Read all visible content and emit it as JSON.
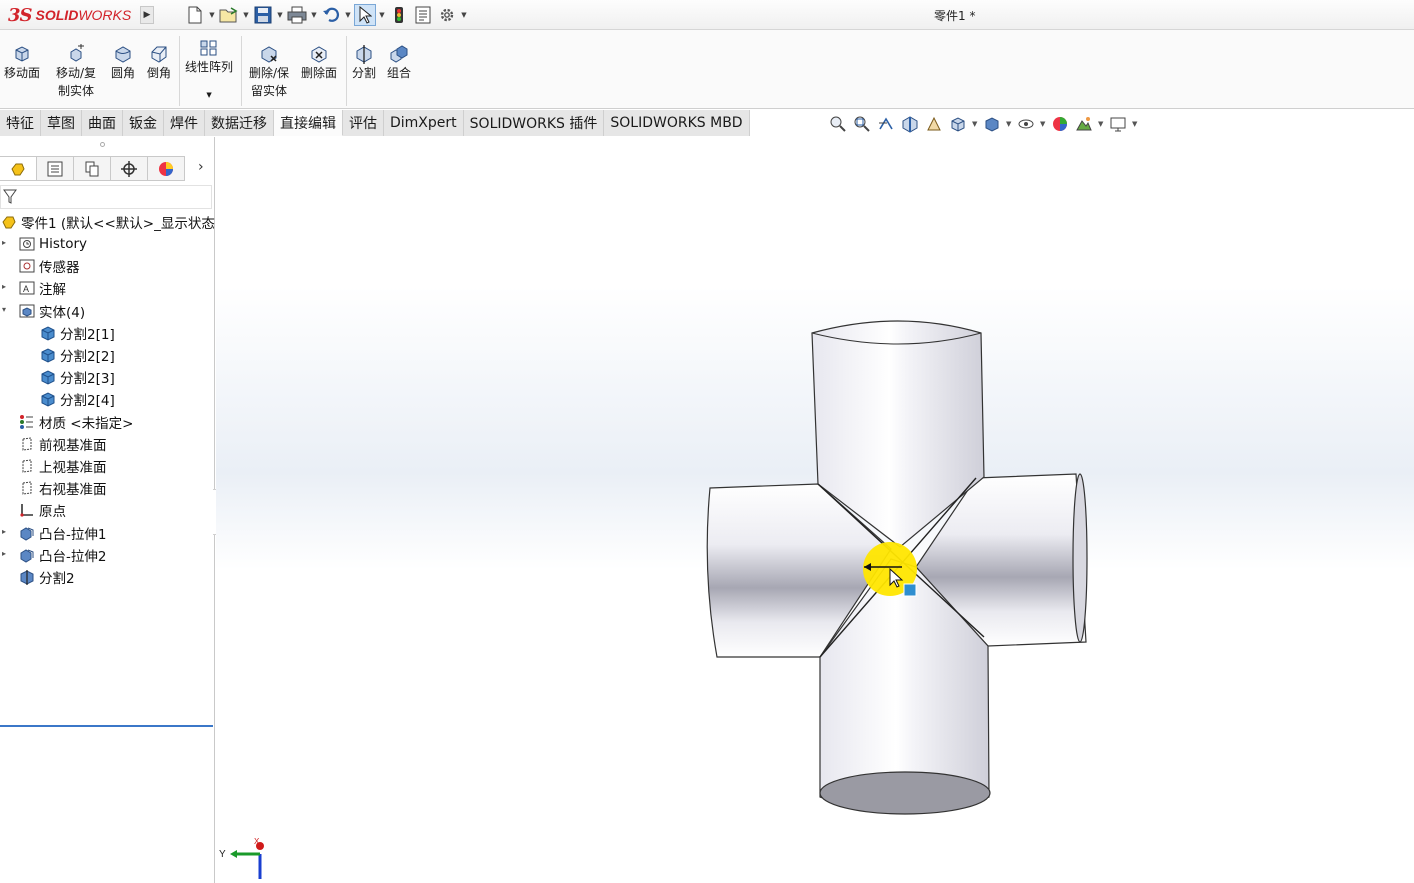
{
  "app": {
    "logo_ds": "3S",
    "logo_solid": "SOLID",
    "logo_works": "WORKS",
    "window_title": "零件1 *"
  },
  "quick_access": {
    "icons": [
      "new-document-icon",
      "open-icon",
      "save-icon",
      "print-icon",
      "undo-icon",
      "select-icon",
      "traffic-light-icon",
      "file-properties-icon",
      "options-gear-icon"
    ]
  },
  "ribbon": {
    "buttons": [
      {
        "label": "移动面"
      },
      {
        "label": "移动/复\n制实体"
      },
      {
        "label": "圆角"
      },
      {
        "label": "倒角"
      },
      {
        "label": "线性阵列"
      },
      {
        "label": "删除/保\n留实体"
      },
      {
        "label": "删除面"
      },
      {
        "label": "分割"
      },
      {
        "label": "组合"
      }
    ]
  },
  "tabs": [
    {
      "label": "特征"
    },
    {
      "label": "草图"
    },
    {
      "label": "曲面"
    },
    {
      "label": "钣金"
    },
    {
      "label": "焊件"
    },
    {
      "label": "数据迁移"
    },
    {
      "label": "直接编辑"
    },
    {
      "label": "评估"
    },
    {
      "label": "DimXpert"
    },
    {
      "label": "SOLIDWORKS 插件"
    },
    {
      "label": "SOLIDWORKS MBD"
    }
  ],
  "active_tab": "直接编辑",
  "feature_tree": {
    "root": "零件1  (默认<<默认>_显示状态",
    "nodes": [
      {
        "label": "History"
      },
      {
        "label": "传感器"
      },
      {
        "label": "注解"
      },
      {
        "label": "实体(4)"
      },
      {
        "label": "分割2[1]"
      },
      {
        "label": "分割2[2]"
      },
      {
        "label": "分割2[3]"
      },
      {
        "label": "分割2[4]"
      },
      {
        "label": "材质 <未指定>"
      },
      {
        "label": "前视基准面"
      },
      {
        "label": "上视基准面"
      },
      {
        "label": "右视基准面"
      },
      {
        "label": "原点"
      },
      {
        "label": "凸台-拉伸1"
      },
      {
        "label": "凸台-拉伸2"
      },
      {
        "label": "分割2"
      }
    ]
  },
  "triad": {
    "y_label": "Y",
    "x_label": "X"
  },
  "colors": {
    "accent": "#3b77c8",
    "brand": "#d2232a",
    "cursor_highlight": "#ffe600"
  }
}
